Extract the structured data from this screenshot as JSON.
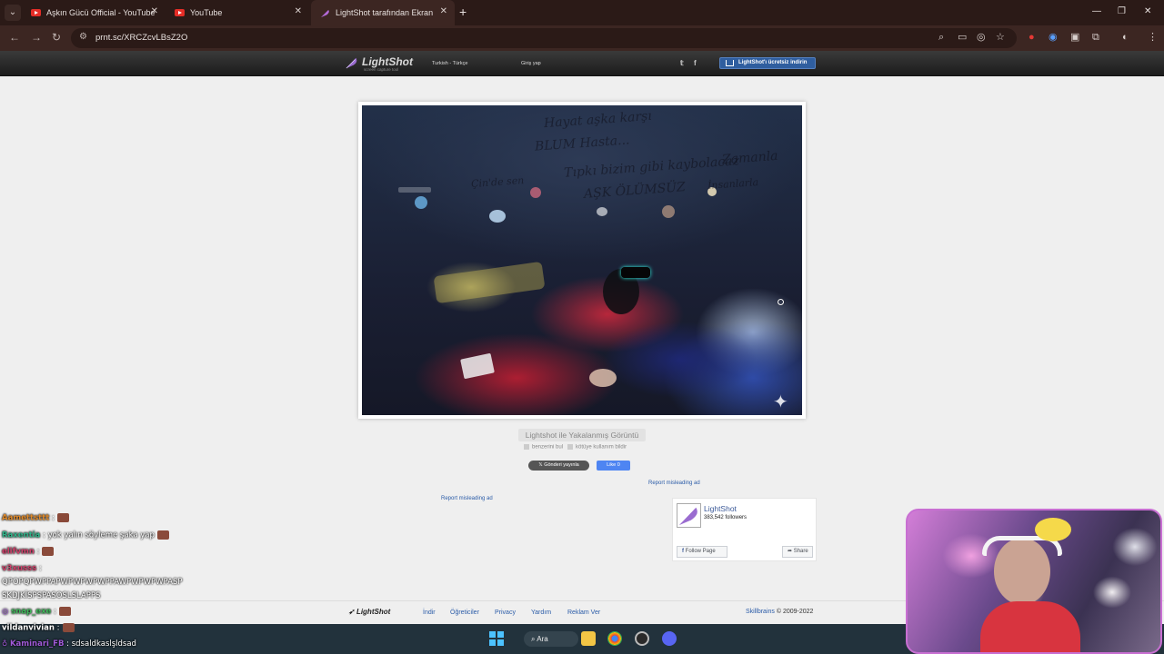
{
  "browser": {
    "tabs": [
      {
        "title": "Aşkın Gücü Official - YouTube",
        "icon": "youtube-icon"
      },
      {
        "title": "YouTube",
        "icon": "youtube-icon"
      },
      {
        "title": "LightShot tarafından Ekran Görü",
        "icon": "lightshot-feather-icon"
      }
    ],
    "url": "prnt.sc/XRCZcvLBsZ2O"
  },
  "lightshot": {
    "logo": "LightShot",
    "tagline": "screen capture tool",
    "language": "Turkish - Türkçe",
    "login": "Giriş yap",
    "download_button": "LightShot'ı ücretsiz indirin",
    "caption": "Lightshot ile Yakalanmış Görüntü",
    "similar_link": "benzerini bul",
    "abuse_link": "kötüye kullanım bildir",
    "tweet_button": "𝕏 Gönderi yayınla",
    "like_button": "Like 0",
    "report_top": "Report misleading ad",
    "report_left": "Report misleading ad",
    "fb": {
      "name": "LightShot",
      "followers": "383,542 followers",
      "follow": "Follow Page",
      "share": "Share"
    },
    "footer": {
      "logo": "LightShot",
      "links": [
        "İndir",
        "Öğreticiler",
        "Privacy",
        "Yardım",
        "Reklam Ver"
      ],
      "company": "Skillbrains",
      "copyright": "© 2009-2022"
    }
  },
  "screenshot_scrawl": [
    "Hayat aşka karşı",
    "BLUM Hasta...",
    "Tıpkı bizim gibi kaybolacaz",
    "Zamanla",
    "AŞK ÖLÜMSÜZ",
    "Çin'de sen",
    "İnsanlarla"
  ],
  "taskbar": {
    "search": "Ara"
  },
  "chat": [
    {
      "user": "Aamettsttt",
      "text": ":",
      "color": "#e08a2a",
      "emote": true
    },
    {
      "user": "Raxentia",
      "text": ": yok yalın söyleme şaka yap",
      "color": "#2fb58a",
      "emote": true
    },
    {
      "user": "elifvmn",
      "text": ":",
      "color": "#d0406a",
      "emote": true
    },
    {
      "user": "v3xusss",
      "text": ":",
      "color": "#d0406a",
      "emote": false
    },
    {
      "user": "",
      "text": "QPOPQPWPPAPWPWPWPWPPAWPWPWPWPASP",
      "color": "#fff",
      "emote": false
    },
    {
      "user": "",
      "text": "SKDJKİSPSPASOSLSLAPPS",
      "color": "#fff",
      "emote": false
    },
    {
      "user": "snap_exe",
      "text": ":",
      "color": "#3fb85a",
      "emote": true
    },
    {
      "user": "vildanvivian",
      "text": ":",
      "color": "#fff",
      "emote": true
    },
    {
      "user": "Kaminari_FB",
      "text": ": sdsaldkaslşldsad",
      "color": "#a05ad8",
      "emote": false
    }
  ]
}
